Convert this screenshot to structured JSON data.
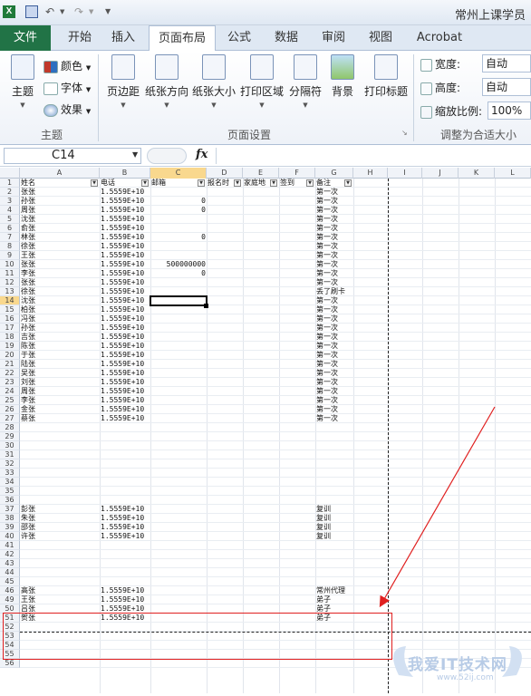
{
  "app": {
    "title": "常州上课学员",
    "xl_glyph": "X",
    "undo_glyph": "↶",
    "redo_glyph": "↷"
  },
  "tabs": [
    {
      "label": "文件",
      "name": "tab-file"
    },
    {
      "label": "开始",
      "name": "tab-home"
    },
    {
      "label": "插入",
      "name": "tab-insert"
    },
    {
      "label": "页面布局",
      "name": "tab-page-layout"
    },
    {
      "label": "公式",
      "name": "tab-formulas"
    },
    {
      "label": "数据",
      "name": "tab-data"
    },
    {
      "label": "审阅",
      "name": "tab-review"
    },
    {
      "label": "视图",
      "name": "tab-view"
    },
    {
      "label": "Acrobat",
      "name": "tab-acrobat"
    }
  ],
  "ribbon": {
    "themes": {
      "group": "主题",
      "main_label": "主题",
      "colors_label": "颜色",
      "fonts_label": "字体",
      "effects_label": "效果"
    },
    "page_setup": {
      "group": "页面设置",
      "margins": "页边距",
      "orientation": "纸张方向",
      "size": "纸张大小",
      "print_area": "打印区域",
      "breaks": "分隔符",
      "background": "背景",
      "print_titles": "打印标题"
    },
    "scale": {
      "group": "调整为合适大小",
      "width_label": "宽度:",
      "width_value": "自动",
      "height_label": "高度:",
      "height_value": "自动",
      "scale_label": "缩放比例:",
      "scale_value": "100%"
    }
  },
  "formula_bar": {
    "name_box": "C14",
    "fx": "fx",
    "value": ""
  },
  "columns": [
    "A",
    "B",
    "C",
    "D",
    "E",
    "F",
    "G",
    "H",
    "I",
    "J",
    "K",
    "L"
  ],
  "selected_column": "C",
  "selected_row": 14,
  "header_row": [
    "姓名",
    "电话",
    "邮箱",
    "报名时",
    "家庭地",
    "签到",
    "备注"
  ],
  "rows": [
    {
      "r": 2,
      "name": "张张",
      "phone": "1.5559E+10",
      "c": "",
      "note": "第一次"
    },
    {
      "r": 3,
      "name": "孙张",
      "phone": "1.5559E+10",
      "c": "0",
      "note": "第一次"
    },
    {
      "r": 4,
      "name": "周张",
      "phone": "1.5559E+10",
      "c": "0",
      "note": "第一次"
    },
    {
      "r": 5,
      "name": "沈张",
      "phone": "1.5559E+10",
      "c": "",
      "note": "第一次"
    },
    {
      "r": 6,
      "name": "俞张",
      "phone": "1.5559E+10",
      "c": "",
      "note": "第一次"
    },
    {
      "r": 7,
      "name": "林张",
      "phone": "1.5559E+10",
      "c": "0",
      "note": "第一次"
    },
    {
      "r": 8,
      "name": "徐张",
      "phone": "1.5559E+10",
      "c": "",
      "note": "第一次"
    },
    {
      "r": 9,
      "name": "王张",
      "phone": "1.5559E+10",
      "c": "",
      "note": "第一次"
    },
    {
      "r": 10,
      "name": "张张",
      "phone": "1.5559E+10",
      "c": "500000000",
      "note": "第一次"
    },
    {
      "r": 11,
      "name": "李张",
      "phone": "1.5559E+10",
      "c": "0",
      "note": "第一次"
    },
    {
      "r": 12,
      "name": "张张",
      "phone": "1.5559E+10",
      "c": "",
      "note": "第一次"
    },
    {
      "r": 13,
      "name": "徐张",
      "phone": "1.5559E+10",
      "c": "",
      "note": "丢了刷卡"
    },
    {
      "r": 14,
      "name": "沈张",
      "phone": "1.5559E+10",
      "c": "",
      "note": "第一次"
    },
    {
      "r": 15,
      "name": "柏张",
      "phone": "1.5559E+10",
      "c": "",
      "note": "第一次"
    },
    {
      "r": 16,
      "name": "冯张",
      "phone": "1.5559E+10",
      "c": "",
      "note": "第一次"
    },
    {
      "r": 17,
      "name": "孙张",
      "phone": "1.5559E+10",
      "c": "",
      "note": "第一次"
    },
    {
      "r": 18,
      "name": "吉张",
      "phone": "1.5559E+10",
      "c": "",
      "note": "第一次"
    },
    {
      "r": 19,
      "name": "陈张",
      "phone": "1.5559E+10",
      "c": "",
      "note": "第一次"
    },
    {
      "r": 20,
      "name": "于张",
      "phone": "1.5559E+10",
      "c": "",
      "note": "第一次"
    },
    {
      "r": 21,
      "name": "陆张",
      "phone": "1.5559E+10",
      "c": "",
      "note": "第一次"
    },
    {
      "r": 22,
      "name": "吴张",
      "phone": "1.5559E+10",
      "c": "",
      "note": "第一次"
    },
    {
      "r": 23,
      "name": "刘张",
      "phone": "1.5559E+10",
      "c": "",
      "note": "第一次"
    },
    {
      "r": 24,
      "name": "周张",
      "phone": "1.5559E+10",
      "c": "",
      "note": "第一次"
    },
    {
      "r": 25,
      "name": "李张",
      "phone": "1.5559E+10",
      "c": "",
      "note": "第一次"
    },
    {
      "r": 26,
      "name": "金张",
      "phone": "1.5559E+10",
      "c": "",
      "note": "第一次"
    },
    {
      "r": 27,
      "name": "蔡张",
      "phone": "1.5559E+10",
      "c": "",
      "note": "第一次"
    },
    {
      "r": 37,
      "name": "彭张",
      "phone": "1.5559E+10",
      "c": "",
      "note": "复训"
    },
    {
      "r": 38,
      "name": "朱张",
      "phone": "1.5559E+10",
      "c": "",
      "note": "复训"
    },
    {
      "r": 39,
      "name": "邵张",
      "phone": "1.5559E+10",
      "c": "",
      "note": "复训"
    },
    {
      "r": 40,
      "name": "许张",
      "phone": "1.5559E+10",
      "c": "",
      "note": "复训"
    },
    {
      "r": 46,
      "name": "高张",
      "phone": "1.5559E+10",
      "c": "",
      "note": "常州代理"
    },
    {
      "r": 49,
      "name": "王张",
      "phone": "1.5559E+10",
      "c": "",
      "note": "弟子"
    },
    {
      "r": 50,
      "name": "吕张",
      "phone": "1.5559E+10",
      "c": "",
      "note": "弟子"
    },
    {
      "r": 51,
      "name": "贺张",
      "phone": "1.5559E+10",
      "c": "",
      "note": "弟子"
    }
  ],
  "visible_row_numbers": [
    1,
    2,
    3,
    4,
    5,
    6,
    7,
    8,
    9,
    10,
    11,
    12,
    13,
    14,
    15,
    16,
    17,
    18,
    19,
    20,
    21,
    22,
    23,
    24,
    25,
    26,
    27,
    28,
    29,
    30,
    31,
    32,
    33,
    34,
    35,
    36,
    37,
    38,
    39,
    40,
    41,
    42,
    43,
    44,
    45,
    46,
    49,
    50,
    51,
    52,
    53,
    54,
    55,
    56
  ],
  "watermark": {
    "text": "我爱IT技术网",
    "url": "www.52ij.com"
  },
  "colors": {
    "excel_green": "#217346",
    "annotation_red": "#e02020",
    "selected_header": "#f9d88e"
  }
}
